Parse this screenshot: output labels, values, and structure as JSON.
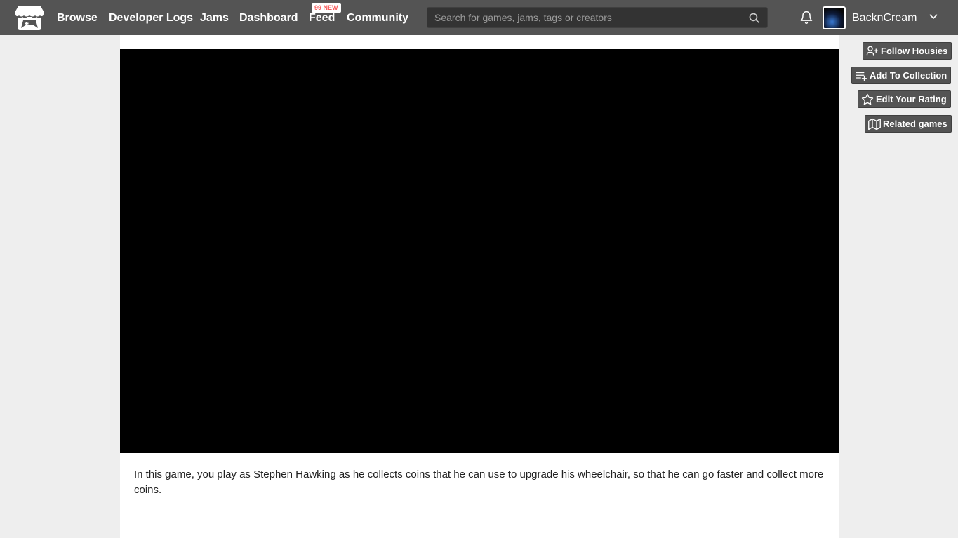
{
  "nav": {
    "items": [
      {
        "label": "Browse"
      },
      {
        "label": "Developer Logs"
      },
      {
        "label": "Jams"
      },
      {
        "label": "Dashboard"
      },
      {
        "label": "Feed"
      },
      {
        "label": "Community"
      }
    ],
    "feed_badge": "99 NEW"
  },
  "search": {
    "value": "",
    "placeholder": "Search for games, jams, tags or creators"
  },
  "user": {
    "name": "BacknCream"
  },
  "actions": {
    "follow_label": "Follow Housies",
    "collection_label": "Add To Collection",
    "rating_label": "Edit Your Rating",
    "related_label": "Related games"
  },
  "game": {
    "description": "In this game, you play as Stephen Hawking as he collects coins that he can use to upgrade his wheelchair, so that he can go faster and collect more coins."
  },
  "icons": {
    "logo": "itchio-logo-icon",
    "search": "search-icon",
    "bell": "bell-icon",
    "chevron": "chevron-down-icon",
    "follow": "user-plus-icon",
    "collection": "playlist-add-icon",
    "rating": "star-icon",
    "related": "map-icon"
  },
  "colors": {
    "header_bg": "#545454",
    "badge_text": "#fa5c5c",
    "page_bg": "#eeeeee"
  }
}
